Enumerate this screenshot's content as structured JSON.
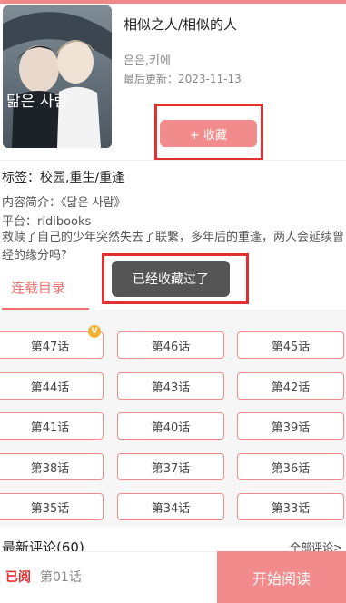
{
  "colors": {
    "accent": "#f28b8b",
    "highlight_red": "#e0312f",
    "toast_bg": "#555555"
  },
  "book": {
    "title": "相似之人/相似的人",
    "authors": "은은,키에",
    "updated": "最后更新：2023-11-13",
    "cover_text": "닮은 사람"
  },
  "favorite": {
    "label": "+ 收藏"
  },
  "meta": {
    "tags": "标签：校园,重生/重逢",
    "intro": "内容简介：《닮은 사람》",
    "platform": "平台：ridibooks",
    "description": "救赎了自己的少年突然失去了联繫，多年后的重逢，两人会延续曾经的缘分吗?"
  },
  "toast": {
    "text": "已经收藏过了"
  },
  "tabs": {
    "serial": "连载目录"
  },
  "chapters": [
    "第47话",
    "第46话",
    "第45话",
    "第44话",
    "第43话",
    "第42话",
    "第41话",
    "第40话",
    "第39话",
    "第38话",
    "第37话",
    "第36话",
    "第35话",
    "第34话",
    "第33话"
  ],
  "chapter_badge": "V",
  "comments": {
    "title": "最新评论(60)",
    "all_link": "全部评论>"
  },
  "bottom": {
    "read_status": "已阅",
    "read_chapter": "第01话",
    "start_button": "开始阅读"
  }
}
